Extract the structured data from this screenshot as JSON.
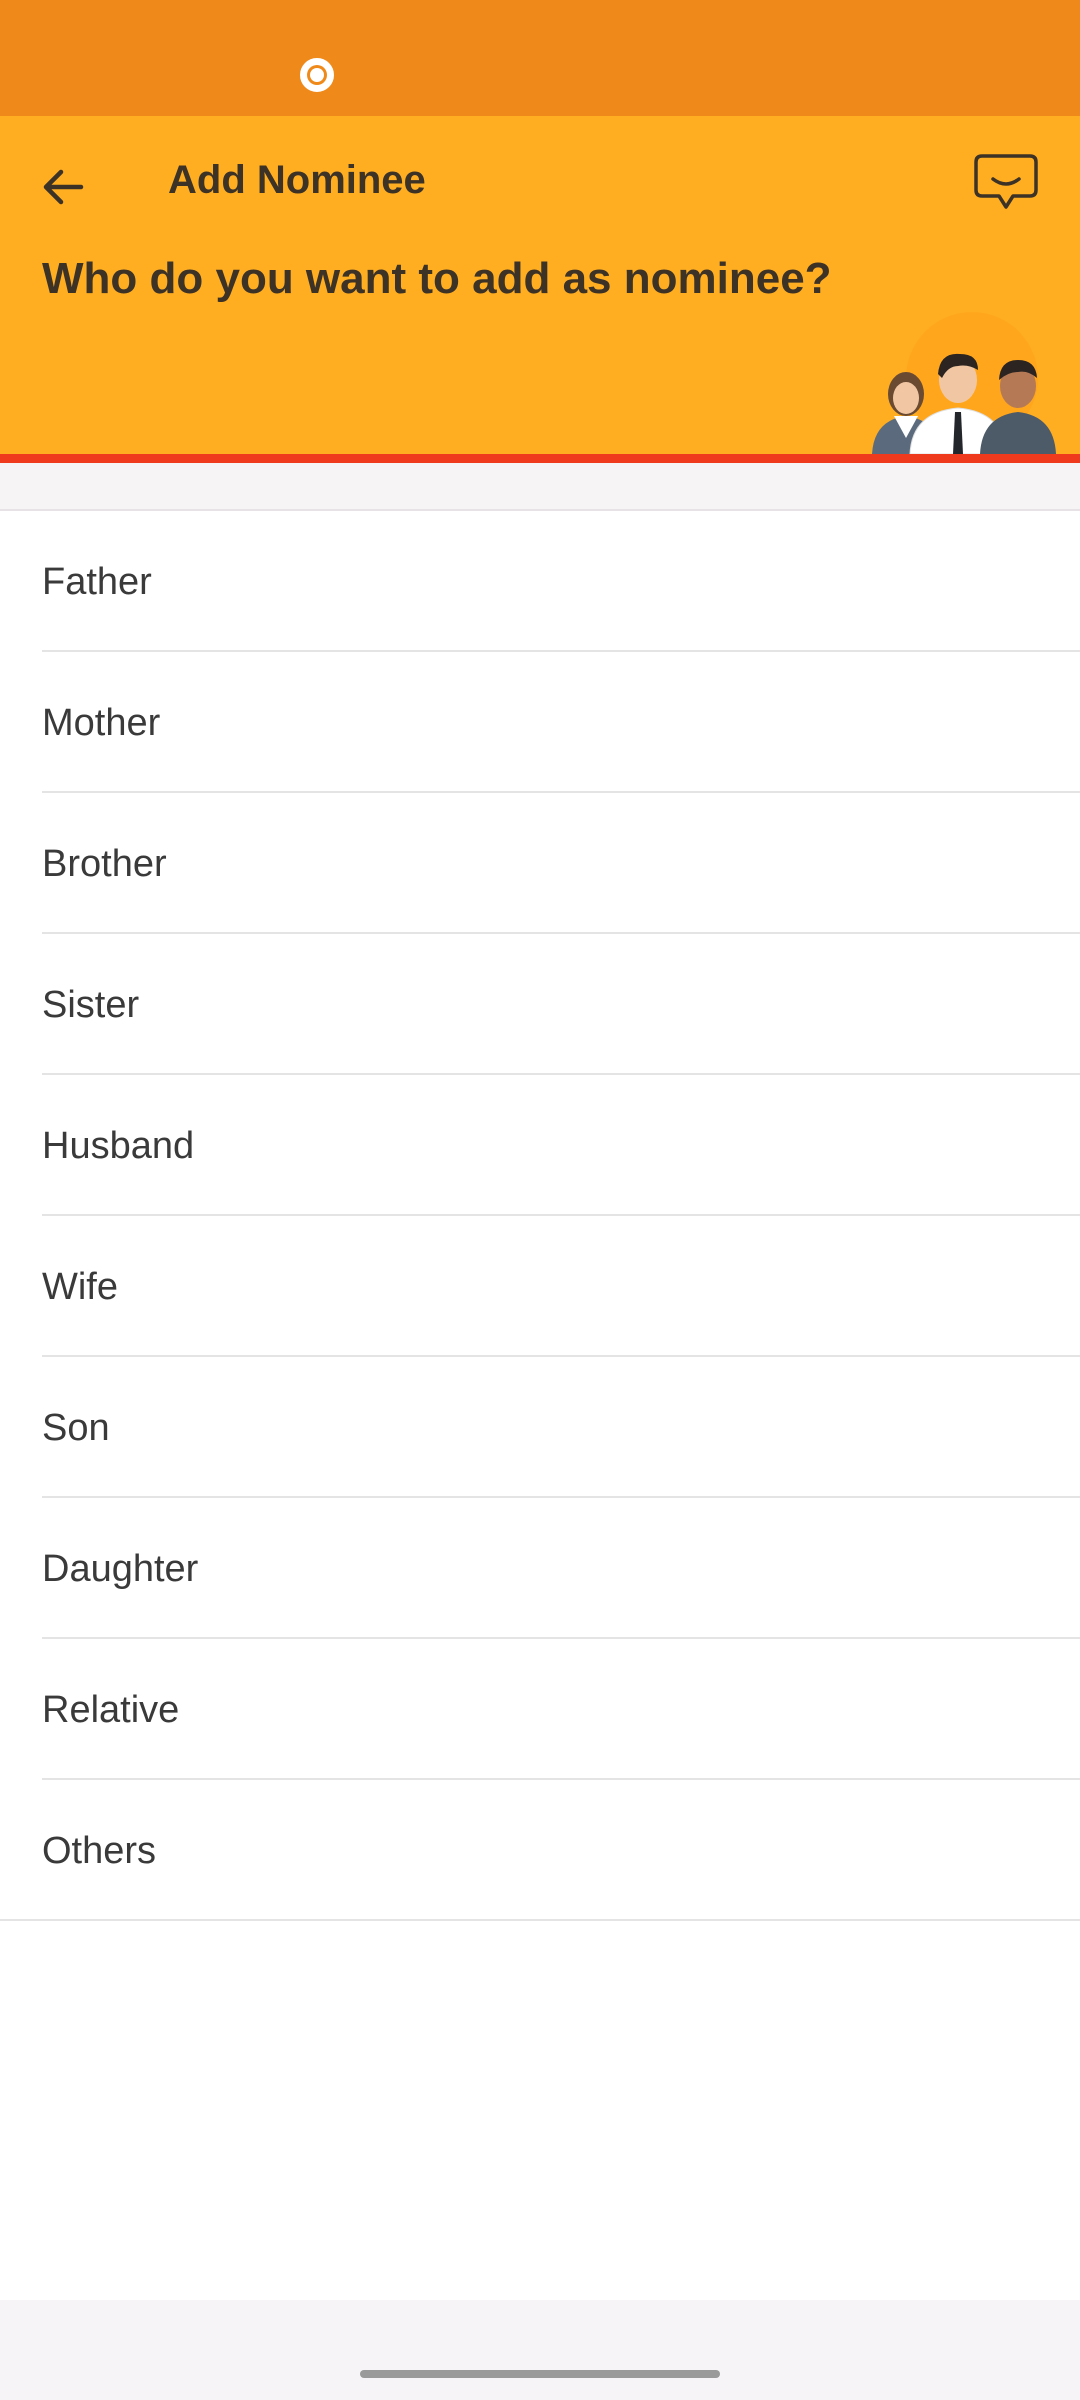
{
  "header": {
    "title": "Add Nominee",
    "question": "Who do you want to add as nominee?"
  },
  "icons": {
    "back": "arrow-left-icon",
    "chat": "chat-bubble-icon",
    "status": "record-dot-icon"
  },
  "relations": [
    {
      "label": "Father"
    },
    {
      "label": "Mother"
    },
    {
      "label": "Brother"
    },
    {
      "label": "Sister"
    },
    {
      "label": "Husband"
    },
    {
      "label": "Wife"
    },
    {
      "label": "Son"
    },
    {
      "label": "Daughter"
    },
    {
      "label": "Relative"
    },
    {
      "label": "Others"
    }
  ],
  "colors": {
    "status_bar": "#ef8a1a",
    "header": "#ffae22",
    "accent_line": "#f03a1e"
  }
}
